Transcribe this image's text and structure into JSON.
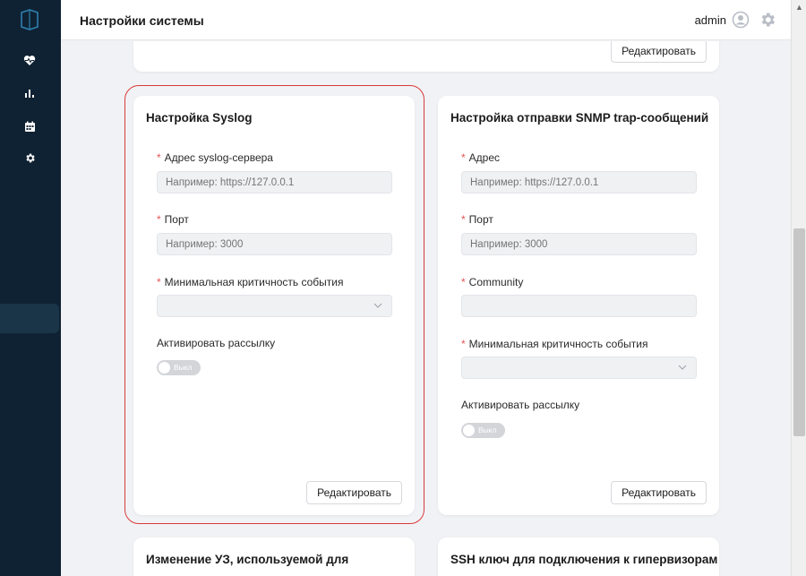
{
  "header": {
    "title": "Настройки системы",
    "username": "admin"
  },
  "sidebar": {
    "icons": [
      "logo-book-icon",
      "heart-pulse-icon",
      "bar-chart-icon",
      "calendar-icon",
      "gear-icon"
    ]
  },
  "top_card": {
    "edit_button": "Редактировать"
  },
  "syslog_card": {
    "title": "Настройка Syslog",
    "address_label": "Адрес syslog-сервера",
    "address_placeholder": "Например: https://127.0.0.1",
    "port_label": "Порт",
    "port_placeholder": "Например: 3000",
    "severity_label": "Минимальная критичность события",
    "severity_value": "",
    "activate_label": "Активировать рассылку",
    "toggle_text": "Выкл",
    "edit_button": "Редактировать"
  },
  "snmp_card": {
    "title": "Настройка отправки SNMP trap-сообщений",
    "address_label": "Адрес",
    "address_placeholder": "Например: https://127.0.0.1",
    "port_label": "Порт",
    "port_placeholder": "Например: 3000",
    "community_label": "Community",
    "community_value": "",
    "severity_label": "Минимальная критичность события",
    "severity_value": "",
    "activate_label": "Активировать рассылку",
    "toggle_text": "Выкл",
    "edit_button": "Редактировать"
  },
  "bottom_left_card": {
    "title": "Изменение УЗ, используемой для"
  },
  "bottom_right_card": {
    "title": "SSH ключ для подключения к гипервизорам"
  },
  "colors": {
    "sidebar_bg": "#0f2233",
    "accent_icon": "#4da9d9",
    "required_star": "#e45555",
    "highlight_border": "#d93a3a"
  }
}
